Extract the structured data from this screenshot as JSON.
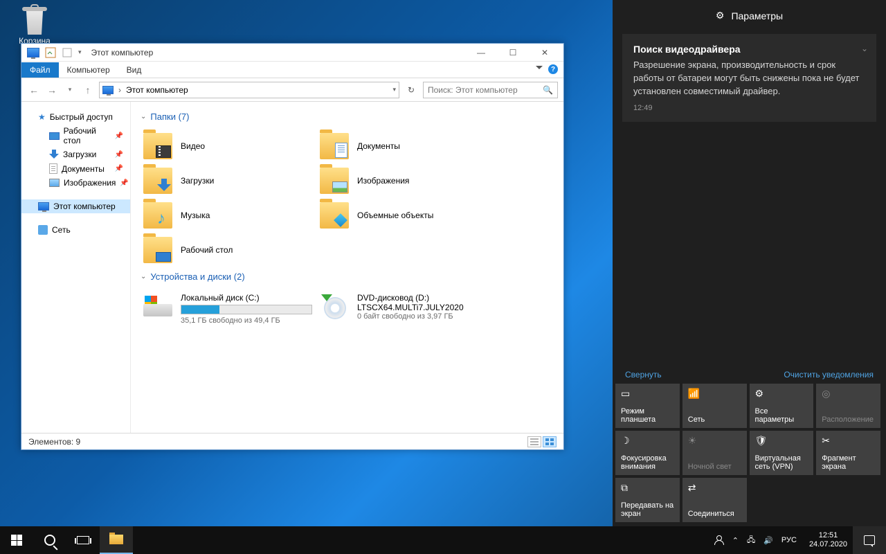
{
  "desktop": {
    "recycle_bin": "Корзина"
  },
  "explorer": {
    "title": "Этот компьютер",
    "tabs": {
      "file": "Файл",
      "computer": "Компьютер",
      "view": "Вид"
    },
    "address": {
      "location": "Этот компьютер"
    },
    "search": {
      "placeholder": "Поиск: Этот компьютер"
    },
    "nav": {
      "quick_access": "Быстрый доступ",
      "desktop": "Рабочий стол",
      "downloads": "Загрузки",
      "documents": "Документы",
      "pictures": "Изображения",
      "this_pc": "Этот компьютер",
      "network": "Сеть"
    },
    "sections": {
      "folders": "Папки (7)",
      "drives": "Устройства и диски (2)"
    },
    "folders": {
      "videos": "Видео",
      "documents": "Документы",
      "downloads": "Загрузки",
      "pictures": "Изображения",
      "music": "Музыка",
      "objects3d": "Объемные объекты",
      "desktop": "Рабочий стол"
    },
    "drives": {
      "c": {
        "name": "Локальный диск (C:)",
        "free": "35,1 ГБ свободно из 49,4 ГБ",
        "fill_pct": 29
      },
      "d": {
        "name": "DVD-дисковод (D:)",
        "label": "LTSCX64.MULTi7.JULY2020",
        "free": "0 байт свободно из 3,97 ГБ"
      }
    },
    "status": "Элементов: 9"
  },
  "action_center": {
    "header": "Параметры",
    "notification": {
      "title": "Поиск видеодрайвера",
      "body": "Разрешение экрана, производительность и срок работы от батареи могут быть снижены пока не будет установлен совместимый драйвер.",
      "time": "12:49"
    },
    "collapse": "Свернуть",
    "clear": "Очистить уведомления",
    "tiles": {
      "tablet": "Режим планшета",
      "network": "Сеть",
      "settings": "Все параметры",
      "location": "Расположение",
      "focus": "Фокусировка внимания",
      "nightlight": "Ночной свет",
      "vpn": "Виртуальная сеть (VPN)",
      "snip": "Фрагмент экрана",
      "project": "Передавать на экран",
      "connect": "Соединиться"
    }
  },
  "taskbar": {
    "lang": "РУС",
    "time": "12:51",
    "date": "24.07.2020"
  }
}
